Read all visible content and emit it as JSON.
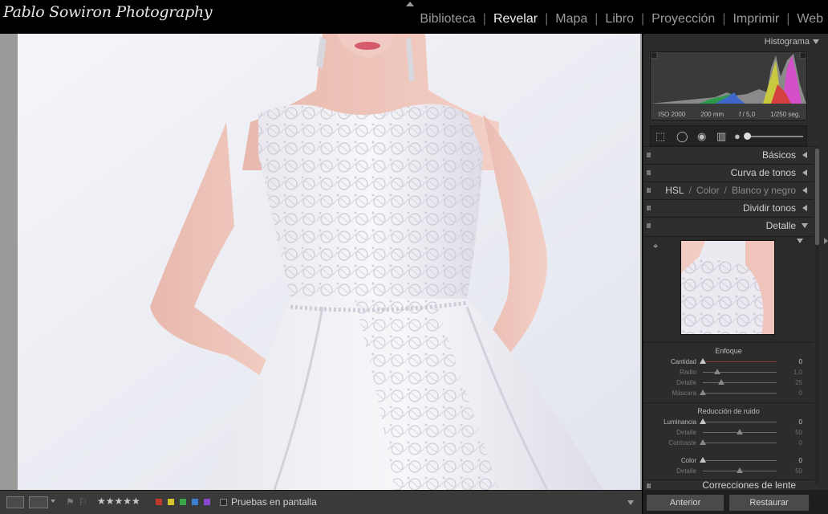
{
  "app": {
    "logo_text": "Pablo Sowiron Photography"
  },
  "modules": [
    "Biblioteca",
    "Revelar",
    "Mapa",
    "Libro",
    "Proyección",
    "Imprimir",
    "Web"
  ],
  "active_module": "Revelar",
  "histogram": {
    "title": "Histograma",
    "iso": "ISO 2000",
    "focal": "200 mm",
    "aperture": "f / 5,0",
    "shutter": "1/250 seg."
  },
  "sections": {
    "basicos": "Básicos",
    "curva": "Curva de tonos",
    "hsl": "HSL",
    "color": "Color",
    "byn": "Blanco y negro",
    "dividir": "Dividir tonos",
    "detalle": "Detalle",
    "correcciones": "Correcciones de lente"
  },
  "enfoque": {
    "title": "Enfoque",
    "rows": [
      {
        "label": "Cantidad",
        "value": "0",
        "level": 0.0
      },
      {
        "label": "Radio",
        "value": "1,0",
        "level": 0.2
      },
      {
        "label": "Detalle",
        "value": "25",
        "level": 0.25
      },
      {
        "label": "Máscara",
        "value": "0",
        "level": 0.0
      }
    ]
  },
  "ruido": {
    "title": "Reducción de ruido",
    "rows": [
      {
        "label": "Luminancia",
        "value": "0",
        "level": 0.0
      },
      {
        "label": "Detalle",
        "value": "50",
        "level": 0.5
      },
      {
        "label": "Contraste",
        "value": "0",
        "level": 0.0
      },
      {
        "label": "Color",
        "value": "0",
        "level": 0.0
      },
      {
        "label": "Detalle",
        "value": "50",
        "level": 0.5
      }
    ]
  },
  "toolbar": {
    "softproof_label": "Pruebas en pantalla",
    "rating": "★★★★★",
    "label_colors": [
      "#c0392b",
      "#d4c42a",
      "#3aa84a",
      "#3a7fd4",
      "#8a4ad0"
    ]
  },
  "buttons": {
    "previous": "Anterior",
    "reset": "Restaurar"
  }
}
